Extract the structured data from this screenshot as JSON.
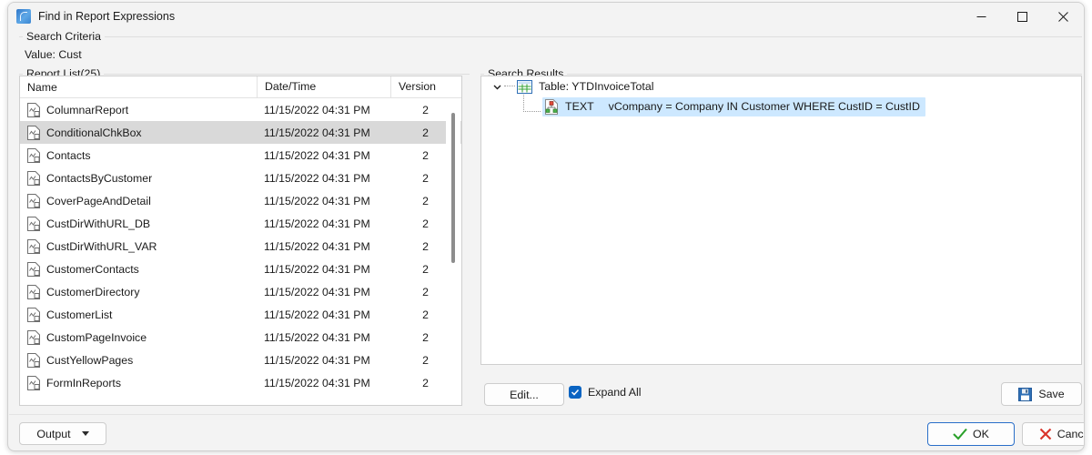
{
  "window": {
    "title": "Find in Report Expressions",
    "app_icon": "report-app-icon",
    "minimize_icon": "minimize-icon",
    "maximize_icon": "maximize-icon",
    "close_icon": "close-icon"
  },
  "search_criteria": {
    "group_label": "Search Criteria",
    "value_line": "Value: Cust"
  },
  "report_list": {
    "group_label": "Report List(25)",
    "columns": [
      "Name",
      "Date/Time",
      "Version"
    ],
    "rows": [
      {
        "name": "ColumnarReport",
        "date": "11/15/2022 04:31 PM",
        "version": "2",
        "selected": false
      },
      {
        "name": "ConditionalChkBox",
        "date": "11/15/2022 04:31 PM",
        "version": "2",
        "selected": true
      },
      {
        "name": "Contacts",
        "date": "11/15/2022 04:31 PM",
        "version": "2",
        "selected": false
      },
      {
        "name": "ContactsByCustomer",
        "date": "11/15/2022 04:31 PM",
        "version": "2",
        "selected": false
      },
      {
        "name": "CoverPageAndDetail",
        "date": "11/15/2022 04:31 PM",
        "version": "2",
        "selected": false
      },
      {
        "name": "CustDirWithURL_DB",
        "date": "11/15/2022 04:31 PM",
        "version": "2",
        "selected": false
      },
      {
        "name": "CustDirWithURL_VAR",
        "date": "11/15/2022 04:31 PM",
        "version": "2",
        "selected": false
      },
      {
        "name": "CustomerContacts",
        "date": "11/15/2022 04:31 PM",
        "version": "2",
        "selected": false
      },
      {
        "name": "CustomerDirectory",
        "date": "11/15/2022 04:31 PM",
        "version": "2",
        "selected": false
      },
      {
        "name": "CustomerList",
        "date": "11/15/2022 04:31 PM",
        "version": "2",
        "selected": false
      },
      {
        "name": "CustomPageInvoice",
        "date": "11/15/2022 04:31 PM",
        "version": "2",
        "selected": false
      },
      {
        "name": "CustYellowPages",
        "date": "11/15/2022 04:31 PM",
        "version": "2",
        "selected": false
      },
      {
        "name": "FormInReports",
        "date": "11/15/2022 04:31 PM",
        "version": "2",
        "selected": false
      }
    ],
    "row_icon": "report-document-icon",
    "scrollbar": "vertical-scrollbar"
  },
  "search_results": {
    "group_label": "Search Results",
    "root": {
      "label": "Table: YTDInvoiceTotal",
      "icon": "table-grid-icon",
      "expander_icon": "chevron-down-icon",
      "expanded": true
    },
    "child": {
      "kind": "TEXT",
      "expression": "vCompany = Company IN Customer WHERE CustID = CustID",
      "icon": "expression-node-icon",
      "selected": true,
      "highlight_color": "#cde8ff"
    }
  },
  "results_toolbar": {
    "edit_label": "Edit...",
    "expand_all_label": "Expand All",
    "expand_all_checked": true,
    "checkbox_color": "#0a64c2",
    "save_label": "Save",
    "save_icon": "floppy-save-icon"
  },
  "footer": {
    "output_label": "Output",
    "output_caret_icon": "caret-down-icon",
    "ok_label": "OK",
    "ok_icon": "check-icon",
    "ok_icon_color": "#2aa02a",
    "cancel_label": "Cancel",
    "cancel_icon": "x-icon",
    "cancel_icon_color": "#d9342b"
  }
}
